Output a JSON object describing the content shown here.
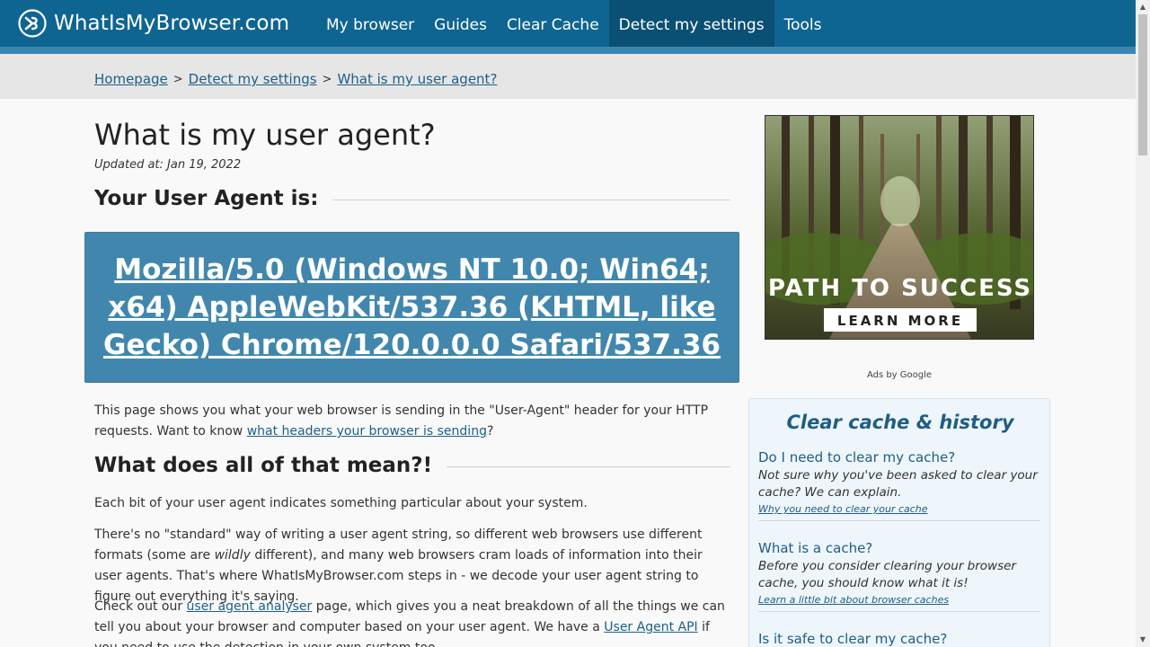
{
  "header": {
    "site_name": "WhatIsMyBrowser.com",
    "nav": [
      {
        "label": "My browser",
        "active": false
      },
      {
        "label": "Guides",
        "active": false
      },
      {
        "label": "Clear Cache",
        "active": false
      },
      {
        "label": "Detect my settings",
        "active": true
      },
      {
        "label": "Tools",
        "active": false
      }
    ],
    "colors": {
      "bar": "#0f6591",
      "active": "#0a4f74",
      "accent_line": "#3a86b3"
    }
  },
  "breadcrumb": {
    "items": [
      "Homepage",
      "Detect my settings",
      "What is my user agent?"
    ],
    "separator": ">"
  },
  "main": {
    "title": "What is my user agent?",
    "updated": "Updated at: Jan 19, 2022",
    "ua_heading": "Your User Agent is:",
    "user_agent": "Mozilla/5.0 (Windows NT 10.0; Win64; x64) AppleWebKit/537.36 (KHTML, like Gecko) Chrome/120.0.0.0 Safari/537.36",
    "intro_text_1": "This page shows you what your web browser is sending in the \"User-Agent\" header for your HTTP requests. Want to know ",
    "intro_link": "what headers your browser is sending",
    "intro_text_2": "?",
    "section2_heading": "What does all of that mean?!",
    "p1": "Each bit of your user agent indicates something particular about your system.",
    "p2_a": "There's no \"standard\" way of writing a user agent string, so different web browsers use different formats (some are ",
    "p2_em": "wildly",
    "p2_b": " different), and many web browsers cram loads of information into their user agents. That's where WhatIsMyBrowser.com steps in - we decode your user agent string to figure out everything it's saying.",
    "p3_a": "Check out our ",
    "p3_link1": "user agent analyser",
    "p3_b": " page, which gives you a neat breakdown of all the things we can tell you about your browser and computer based on your user agent. We have a ",
    "p3_link2": "User Agent API",
    "p3_c": " if you need to use the detection in your own system too."
  },
  "ad": {
    "headline": "PATH TO SUCCESS",
    "button": "LEARN MORE",
    "ads_by": "Ads by Google"
  },
  "sidebar": {
    "title": "Clear cache & history",
    "items": [
      {
        "question": "Do I need to clear my cache?",
        "desc": "Not sure why you've been asked to clear your cache? We can explain.",
        "link": "Why you need to clear your cache"
      },
      {
        "question": "What is a cache?",
        "desc": "Before you consider clearing your browser cache, you should know what it is!",
        "link": "Learn a little bit about browser caches"
      },
      {
        "question": "Is it safe to clear my cache?",
        "desc": "",
        "link": ""
      }
    ]
  },
  "icons": {
    "logo": "whatismybrowser-logo-icon",
    "scroll_up": "scroll-up-arrow-icon",
    "scroll_down": "scroll-down-arrow-icon"
  }
}
